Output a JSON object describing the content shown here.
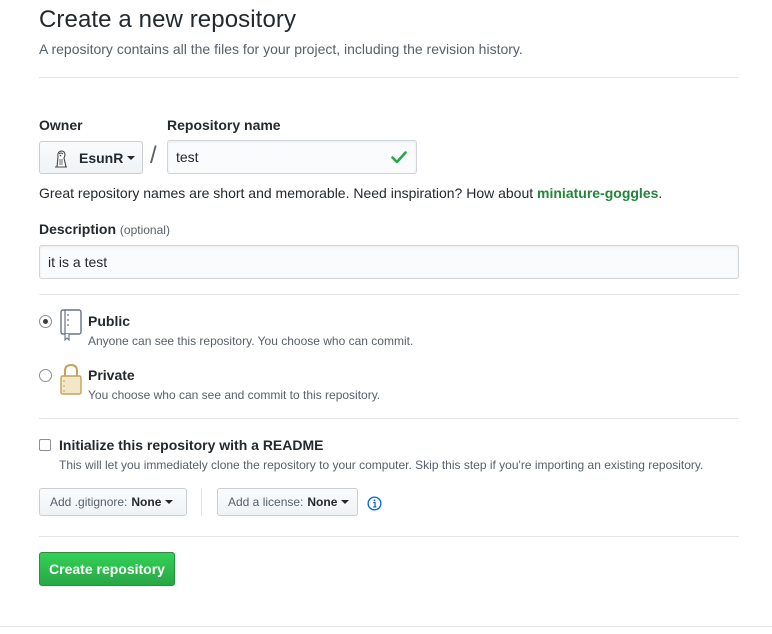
{
  "header": {
    "title": "Create a new repository",
    "subtitle": "A repository contains all the files for your project, including the revision history."
  },
  "form": {
    "owner_label": "Owner",
    "owner_value": "EsunR",
    "separator": "/",
    "repo_name_label": "Repository name",
    "repo_name_value": "test",
    "hint_text": "Great repository names are short and memorable. Need inspiration? How about ",
    "hint_suggestion": "miniature-goggles",
    "hint_end": ".",
    "description_label": "Description",
    "description_optional": "(optional)",
    "description_value": "it is a test"
  },
  "visibility": {
    "public": {
      "title": "Public",
      "description": "Anyone can see this repository. You choose who can commit.",
      "selected": true,
      "icon": "repo-icon"
    },
    "private": {
      "title": "Private",
      "description": "You choose who can see and commit to this repository.",
      "selected": false,
      "icon": "lock-icon"
    }
  },
  "init": {
    "readme_title": "Initialize this repository with a README",
    "readme_description": "This will let you immediately clone the repository to your computer. Skip this step if you're importing an existing repository.",
    "readme_checked": false,
    "gitignore_label": "Add .gitignore:",
    "gitignore_value": "None",
    "license_label": "Add a license:",
    "license_value": "None"
  },
  "actions": {
    "create_label": "Create repository"
  },
  "colors": {
    "accent_green": "#28a745",
    "suggestion_green": "#22863a",
    "info_blue": "#0366d6",
    "border": "#e1e4e8"
  }
}
